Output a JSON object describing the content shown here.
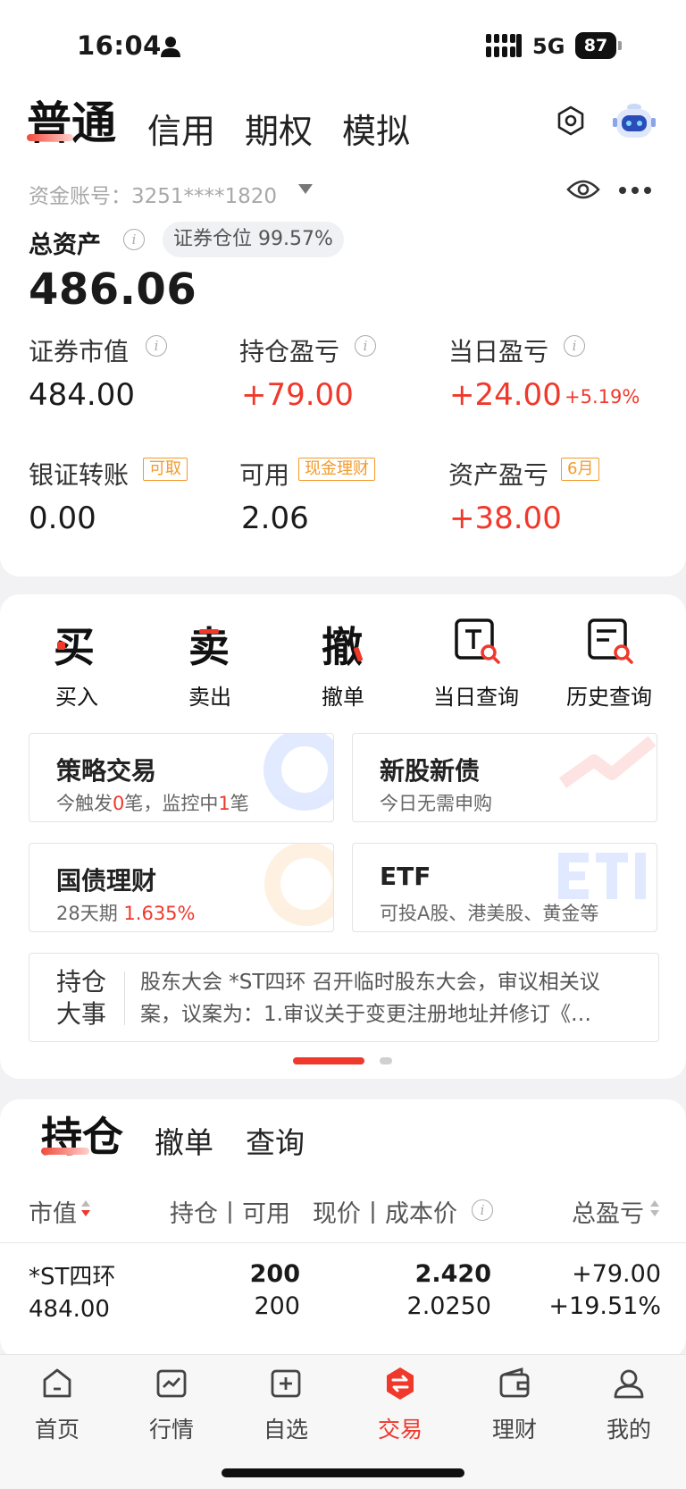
{
  "status_bar": {
    "time": "16:04",
    "network": "5G",
    "battery": "87"
  },
  "account_tabs": [
    "普通",
    "信用",
    "期权",
    "模拟"
  ],
  "account": {
    "label": "资金账号：3251****1820"
  },
  "summary": {
    "total_assets_label": "总资产",
    "position_badge": "证券仓位 99.57%",
    "total_assets_value": "486.06",
    "metrics": [
      {
        "label": "证券市值",
        "value": "484.00"
      },
      {
        "label": "持仓盈亏",
        "value": "+79.00"
      },
      {
        "label": "当日盈亏",
        "value": "+24.00",
        "extra": "+5.19%"
      },
      {
        "label": "银证转账",
        "tag": "可取",
        "value": "0.00"
      },
      {
        "label": "可用",
        "tag": "现金理财",
        "value": "2.06"
      },
      {
        "label": "资产盈亏",
        "tag": "6月",
        "value": "+38.00"
      }
    ]
  },
  "quick_actions": [
    {
      "glyph": "买",
      "label": "买入"
    },
    {
      "glyph": "卖",
      "label": "卖出"
    },
    {
      "glyph": "撤",
      "label": "撤单"
    },
    {
      "label": "当日查询"
    },
    {
      "label": "历史查询"
    }
  ],
  "tiles": [
    {
      "title": "策略交易",
      "sub_parts": [
        "今触发",
        "0",
        "笔，监控中",
        "1",
        "笔"
      ]
    },
    {
      "title": "新股新债",
      "sub": "今日无需申购"
    },
    {
      "title": "国债理财",
      "sub_days": "28天期",
      "sub_rate": "1.635%"
    },
    {
      "title": "ETF",
      "sub": "可投A股、港美股、黄金等"
    }
  ],
  "news": {
    "label": "持仓大事",
    "text": "股东大会 *ST四环 召开临时股东大会，审议相关议案，议案为：1.审议关于变更注册地址并修订《…"
  },
  "holdings_tabs": [
    "持仓",
    "撤单",
    "查询"
  ],
  "holdings_columns": {
    "market_value": "市值",
    "position_available": "持仓丨可用",
    "price_cost": "现价丨成本价",
    "total_pnl": "总盈亏"
  },
  "holdings": [
    {
      "name": "*ST四环",
      "market_value": "484.00",
      "position": "200",
      "available": "200",
      "price": "2.420",
      "cost": "2.0250",
      "pnl": "+79.00",
      "pnl_pct": "+19.51%"
    }
  ],
  "bottom_nav": [
    {
      "label": "首页",
      "icon": "home-icon"
    },
    {
      "label": "行情",
      "icon": "market-chart-icon"
    },
    {
      "label": "自选",
      "icon": "watchlist-add-icon"
    },
    {
      "label": "交易",
      "icon": "trade-icon",
      "active": true
    },
    {
      "label": "理财",
      "icon": "wallet-icon"
    },
    {
      "label": "我的",
      "icon": "profile-icon"
    }
  ],
  "colors": {
    "accent_red": "#f0382b",
    "tag_orange": "#f39a2b"
  }
}
